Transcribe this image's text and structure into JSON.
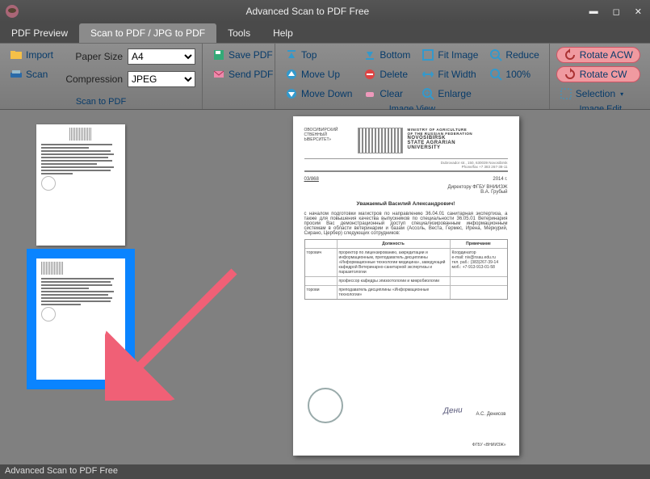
{
  "app": {
    "title": "Advanced Scan to PDF Free",
    "status": "Advanced Scan to PDF Free"
  },
  "menu": {
    "pdf_preview": "PDF Preview",
    "scan_tab": "Scan to PDF / JPG to PDF",
    "tools": "Tools",
    "help": "Help"
  },
  "ribbon": {
    "import": "Import",
    "scan": "Scan",
    "paper_size_label": "Paper Size",
    "paper_size_value": "A4",
    "compression_label": "Compression",
    "compression_value": "JPEG",
    "save_pdf": "Save PDF",
    "send_pdf": "Send PDF",
    "scan_group": "Scan to PDF",
    "top": "Top",
    "move_up": "Move Up",
    "move_down": "Move Down",
    "bottom": "Bottom",
    "delete": "Delete",
    "clear": "Clear",
    "fit_image": "Fit Image",
    "fit_width": "Fit Width",
    "enlarge": "Enlarge",
    "reduce": "Reduce",
    "pct100": "100%",
    "image_view_group": "Image View",
    "rotate_acw": "Rotate ACW",
    "rotate_cw": "Rotate CW",
    "selection": "Selection",
    "image_edit_group": "Image Edit"
  },
  "preview_doc": {
    "org_left": "ОВОСИБИРСКИЙ\nСТВЕННЫЙ\nЫВЕРСИТЕТ»",
    "uni1": "MINISTRY OF AGRICULTURE\nOF THE RUSSIAN FEDERATION",
    "uni2": "NOVOSIBIRSK\nSTATE AGRARIAN\nUNIVERSITY",
    "date_left": "03/868",
    "date_right": "2014 г.",
    "addr": "Директору ФГБУ ВНИИЗЖ\nВ.А. Грубый",
    "greeting": "Уважаемый Василий Александрович!",
    "body1": "с началом подготовки магистров по направлению 36.04.01 санитарная экспертиза, а также для повышения качества выпускников по специальности 36.05.01 Ветеринария просим Вас демонстрационный доступ специализированным информационным системам в области ветеринарии и базам (Ассоль, Веста, Гермес, Ирена, Меркурий, Сирано, Цербер) следующих сотрудников:",
    "col1": "Должность",
    "col2": "Примечание",
    "r1a": "торович",
    "r1b": "проректор по лицензированию, аккредитации и информационным, преподаватель дисциплины «Информационные технологии медицина», заведующий кафедрой Ветеринарно-санитарной экспертизы и паразитологии",
    "r1c": "Координатор\ne-mail: niv@nsau.edu.ru\nтел. раб.: (383)267-39-14\nмоб.: +7-913-913-01-58",
    "r2b": "профессор кафедры эпизоотологии и микробиологии",
    "r3b": "преподаватель дисциплины «Информационные технологии»",
    "signer": "А.С. Денисов",
    "footer": "ФГБУ «ВНИИЗЖ»"
  }
}
